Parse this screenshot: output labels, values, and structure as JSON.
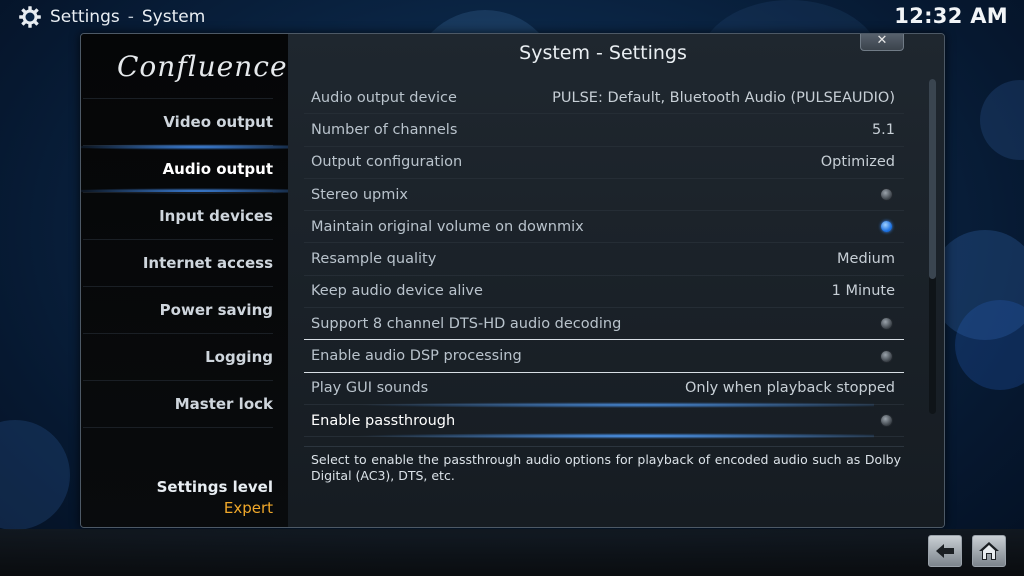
{
  "header": {
    "section": "Settings",
    "separator": "-",
    "subsection": "System",
    "clock": "12:32 AM"
  },
  "dialog": {
    "logo": "Confluence",
    "title": "System - Settings",
    "close_label": "✕"
  },
  "sidebar": {
    "items": [
      {
        "label": "Video output",
        "active": false
      },
      {
        "label": "Audio output",
        "active": true
      },
      {
        "label": "Input devices",
        "active": false
      },
      {
        "label": "Internet access",
        "active": false
      },
      {
        "label": "Power saving",
        "active": false
      },
      {
        "label": "Logging",
        "active": false
      },
      {
        "label": "Master lock",
        "active": false
      }
    ],
    "settings_level_label": "Settings level",
    "settings_level_value": "Expert"
  },
  "settings": [
    {
      "label": "Audio output device",
      "value": "PULSE: Default, Bluetooth Audio (PULSEAUDIO)"
    },
    {
      "label": "Number of channels",
      "value": "5.1"
    },
    {
      "label": "Output configuration",
      "value": "Optimized"
    },
    {
      "label": "Stereo upmix",
      "toggle": "off"
    },
    {
      "label": "Maintain original volume on downmix",
      "toggle": "on"
    },
    {
      "label": "Resample quality",
      "value": "Medium"
    },
    {
      "label": "Keep audio device alive",
      "value": "1 Minute"
    },
    {
      "label": "Support 8 channel DTS-HD audio decoding",
      "toggle": "off"
    },
    {
      "label": "Enable audio DSP processing",
      "toggle": "off"
    },
    {
      "label": "Play GUI sounds",
      "value": "Only when playback stopped"
    },
    {
      "label": "Enable passthrough",
      "toggle": "off",
      "selected": true
    }
  ],
  "description": "Select to enable the passthrough audio options for playback of encoded audio such as Dolby Digital (AC3), DTS, etc.",
  "colors": {
    "accent": "#3b8fff",
    "settings_level": "#f0a82a"
  },
  "icons": {
    "header": "gear-icon",
    "back": "back-arrow-icon",
    "home": "home-icon"
  }
}
